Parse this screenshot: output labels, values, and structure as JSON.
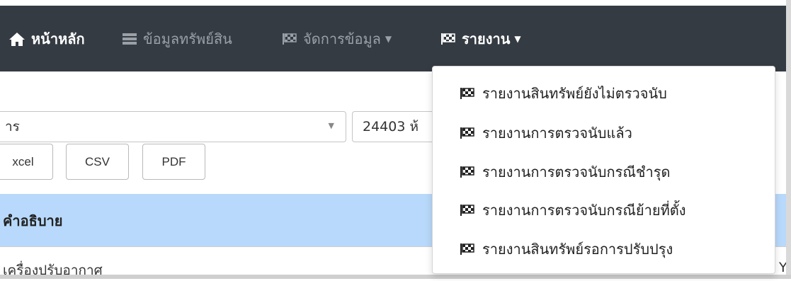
{
  "navbar": {
    "home": {
      "label": "หน้าหลัก",
      "icon": "home-icon"
    },
    "assets": {
      "label": "ข้อมูลทรัพย์สิน",
      "icon": "database-icon"
    },
    "manage": {
      "label": "จัดการข้อมูล",
      "icon": "flag-checkered-icon"
    },
    "report": {
      "label": "รายงาน",
      "icon": "flag-checkered-icon"
    }
  },
  "filters": {
    "select1_value": "าร",
    "select2_value": "24403 ห้"
  },
  "export_buttons": {
    "excel": "xcel",
    "csv": "CSV",
    "pdf": "PDF"
  },
  "table": {
    "header_desc": "คำอธิบาย",
    "row1_desc": "เครื่องปรับอากาศ",
    "row1_right": "Y"
  },
  "report_menu": {
    "items": [
      "รายงานสินทรัพย์ยังไม่ตรวจนับ",
      "รายงานการตรวจนับแล้ว",
      "รายงานการตรวจนับกรณีชำรุด",
      "รายงานการตรวจนับกรณีย้ายที่ตั้ง",
      "รายงานสินทรัพย์รอการปรับปรุง"
    ]
  },
  "colors": {
    "navbar_bg": "#353b43",
    "table_header_bg": "#b8d9fb"
  }
}
